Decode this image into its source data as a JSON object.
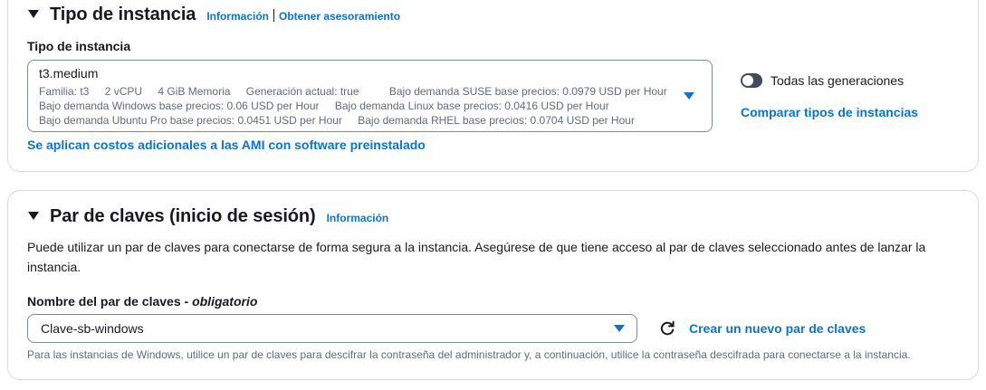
{
  "instance_section": {
    "title": "Tipo de instancia",
    "info_link": "Información",
    "advice_link": "Obtener asesoramiento",
    "field_label": "Tipo de instancia",
    "selected": {
      "name": "t3.medium",
      "family": "Familia: t3",
      "vcpu": "2 vCPU",
      "memory": "4 GiB Memoria",
      "generation": "Generación actual: true",
      "suse_price": "Bajo demanda SUSE base precios: 0.0979 USD per Hour",
      "windows_price": "Bajo demanda Windows base precios: 0.06 USD per Hour",
      "linux_price": "Bajo demanda Linux base precios: 0.0416 USD per Hour",
      "ubuntu_pro_price": "Bajo demanda Ubuntu Pro base precios: 0.0451 USD per Hour",
      "rhel_price": "Bajo demanda RHEL base precios: 0.0704 USD per Hour"
    },
    "all_generations_label": "Todas las generaciones",
    "all_generations_enabled": false,
    "compare_link": "Comparar tipos de instancias",
    "ami_costs_link": "Se aplican costos adicionales a las AMI con software preinstalado"
  },
  "keypair_section": {
    "title": "Par de claves (inicio de sesión)",
    "info_link": "Información",
    "description": "Puede utilizar un par de claves para conectarse de forma segura a la instancia. Asegúrese de que tiene acceso al par de claves seleccionado antes de lanzar la instancia.",
    "field_label": "Nombre del par de claves - ",
    "field_required": "obligatorio",
    "selected_value": "Clave-sb-windows",
    "create_link": "Crear un nuevo par de claves",
    "hint": "Para las instancias de Windows, utilice un par de claves para descifrar la contraseña del administrador y, a continuación, utilice la contraseña descifrada para conectarse a la instancia."
  },
  "colors": {
    "link": "#0972d3",
    "text": "#16191f",
    "secondary_text": "#5f6b7a",
    "border": "#d5dbdb",
    "input_border": "#7d8998",
    "toggle_off": "#414d5c"
  },
  "icons": {
    "expand": "caret-down-icon",
    "dropdown": "caret-down-filled-icon",
    "refresh": "refresh-icon"
  }
}
